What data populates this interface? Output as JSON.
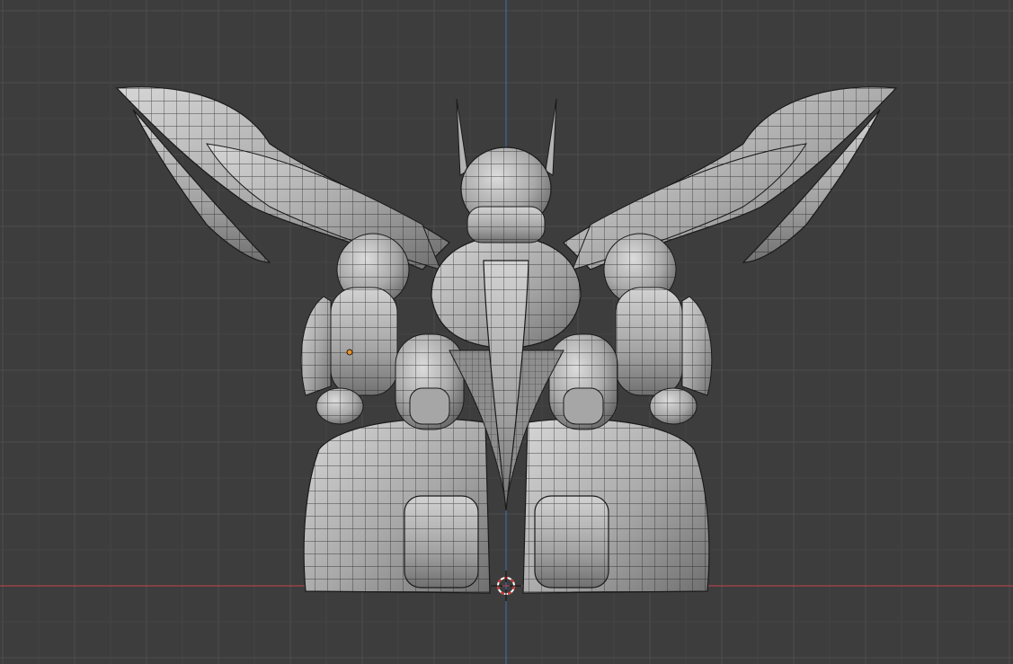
{
  "viewport": {
    "view": "front-orthographic",
    "grid": true,
    "shading": "solid-with-wireframe-overlay"
  },
  "colors": {
    "background": "#3d3d3d",
    "grid_minor": "#454545",
    "grid_major": "#4d4d4d",
    "axis_x": "#c2424d",
    "axis_z": "#3f6fb6",
    "mesh_light": "#c9c9c9",
    "mesh_mid": "#9e9e9e",
    "mesh_dark": "#6a6a6a",
    "wire": "#1a1a1a",
    "origin_dot": "#e8912a",
    "cursor_red": "#d23030",
    "cursor_white": "#ffffff"
  },
  "scene": {
    "object": "mecha-model",
    "selection_origin": "object-origin",
    "cursor": "3d-cursor"
  }
}
